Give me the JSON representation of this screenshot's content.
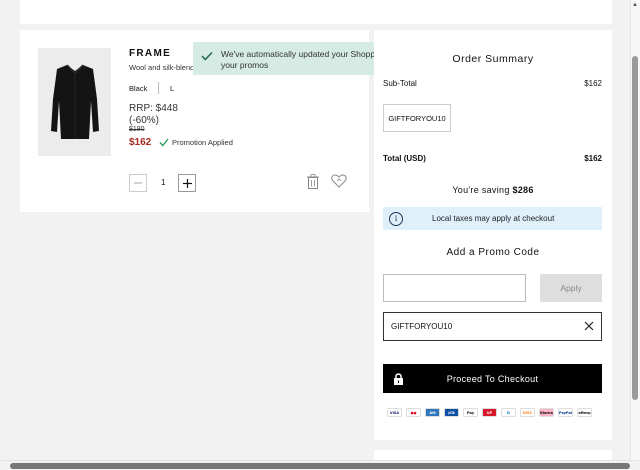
{
  "item": {
    "brand": "FRAME",
    "description": "Wool and silk-blend",
    "color": "Black",
    "size": "L",
    "rrp_line1": "RRP: $448",
    "rrp_line2": "(-60%)",
    "was_price": "$180",
    "now_price": "$162",
    "promotion_label": "Promotion Applied",
    "quantity": "1"
  },
  "toast": {
    "message": "We've automatically updated your Shopping Bag with your promos"
  },
  "summary": {
    "title": "Order Summary",
    "subtotal_label": "Sub-Total",
    "subtotal_value": "$162",
    "applied_code_chip": "GIFTFORYOU10",
    "total_label": "Total (USD)",
    "total_value": "$162",
    "saving_prefix": "You're saving ",
    "saving_amount": "$286",
    "info_icon_glyph": "i",
    "tax_notice": "Local taxes may apply at checkout",
    "promo_title": "Add a Promo Code",
    "promo_input_value": "",
    "apply_label": "Apply",
    "applied_code": "GIFTFORYOU10",
    "checkout_label": "Proceed To Checkout"
  },
  "payment_methods": [
    {
      "name": "visa",
      "text": "VISA",
      "bg": "#ffffff",
      "fg": "#1a1f71"
    },
    {
      "name": "mastercard",
      "text": "●●",
      "bg": "#ffffff",
      "fg": "#eb001b"
    },
    {
      "name": "amex",
      "text": "AM",
      "bg": "#2e77bc",
      "fg": "#ffffff"
    },
    {
      "name": "jcb",
      "text": "JCB",
      "bg": "#0b4ea2",
      "fg": "#ffffff"
    },
    {
      "name": "apple-pay",
      "text": "Pay",
      "bg": "#ffffff",
      "fg": "#000000"
    },
    {
      "name": "unionpay",
      "text": "UP",
      "bg": "#d7182a",
      "fg": "#ffffff"
    },
    {
      "name": "diners",
      "text": "D",
      "bg": "#ffffff",
      "fg": "#0079be"
    },
    {
      "name": "discover",
      "text": "DISC",
      "bg": "#ffffff",
      "fg": "#f58220"
    },
    {
      "name": "klarna",
      "text": "Klarna",
      "bg": "#ffb3c7",
      "fg": "#000000"
    },
    {
      "name": "paypal",
      "text": "PayPal",
      "bg": "#ffffff",
      "fg": "#003087"
    },
    {
      "name": "afterpay",
      "text": "afterp",
      "bg": "#ffffff",
      "fg": "#000000"
    }
  ],
  "colors": {
    "sale_red": "#a8281e",
    "toast_bg": "#d5ebe3",
    "info_bg": "#dff0fb",
    "promo_check": "#2e9b5b"
  }
}
